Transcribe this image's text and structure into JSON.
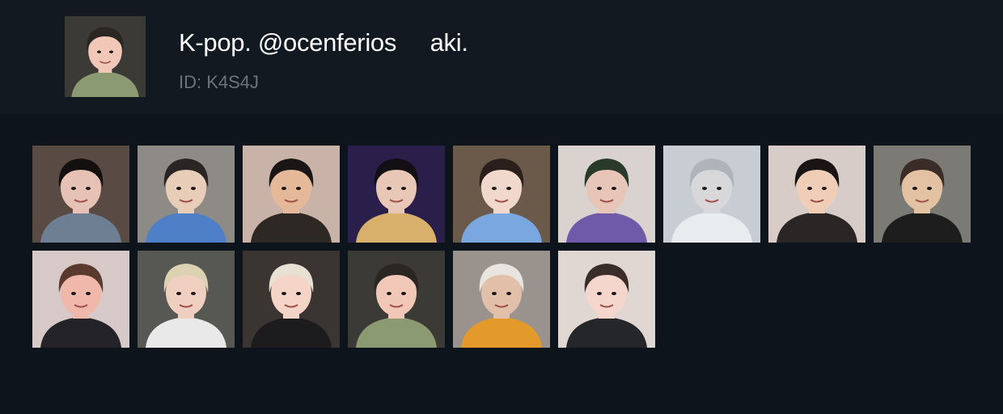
{
  "pack": {
    "title": "K-pop. @ocenferios     aki.",
    "id_label": "ID: K4S4J",
    "cover_sticker": "sticker-hand-over-face"
  },
  "stickers": [
    {
      "name": "sticker-smiling-girl-waving",
      "bg": "#5a4a44",
      "skin": "#e6c2b4",
      "hair": "#141010",
      "cloth": "#6e7f93"
    },
    {
      "name": "sticker-boy-with-camera",
      "bg": "#8e8a86",
      "skin": "#e8cdb8",
      "hair": "#2a2424",
      "cloth": "#4f7fc6"
    },
    {
      "name": "sticker-boy-black-beret",
      "bg": "#c9b3a8",
      "skin": "#e5b89a",
      "hair": "#1b1616",
      "cloth": "#2e2824"
    },
    {
      "name": "sticker-boy-side-profile-neon",
      "bg": "#2a1f4a",
      "skin": "#e8c7b7",
      "hair": "#121014",
      "cloth": "#d9b06b"
    },
    {
      "name": "sticker-boy-at-microphone",
      "bg": "#6b5a4a",
      "skin": "#f0d8cc",
      "hair": "#2b1f1c",
      "cloth": "#7aa7e0"
    },
    {
      "name": "sticker-masked-face-pink-text",
      "bg": "#d9d2cf",
      "skin": "#e7c6b8",
      "hair": "#2a3a2a",
      "cloth": "#6e5aa8"
    },
    {
      "name": "sticker-blurry-white-shirt",
      "bg": "#c7cdd2",
      "skin": "#d8d8da",
      "hair": "#aeb4ba",
      "cloth": "#e8ecef"
    },
    {
      "name": "sticker-smiling-boy-selfie",
      "bg": "#d8ccc8",
      "skin": "#efcdb6",
      "hair": "#1b1414",
      "cloth": "#2b2626"
    },
    {
      "name": "sticker-boy-drinking-bottle",
      "bg": "#7c7a74",
      "skin": "#e3c2a4",
      "hair": "#3a2c26",
      "cloth": "#1d1d1d"
    },
    {
      "name": "sticker-boy-fingers-on-lips",
      "bg": "#d6c9c8",
      "skin": "#f0b8aa",
      "hair": "#5a3a2e",
      "cloth": "#242428"
    },
    {
      "name": "sticker-blonde-drinking-straw",
      "bg": "#575854",
      "skin": "#eecfc0",
      "hair": "#dcd2b2",
      "cloth": "#e9e9ea"
    },
    {
      "name": "sticker-blonde-girl-laughing",
      "bg": "#3a3432",
      "skin": "#f3d4c6",
      "hair": "#e8e0d2",
      "cloth": "#1c1c1f"
    },
    {
      "name": "sticker-hand-over-face",
      "bg": "#3b3a36",
      "skin": "#f1c7b8",
      "hair": "#2a2622",
      "cloth": "#8c9a72"
    },
    {
      "name": "sticker-hoodie-boy-snack-bag",
      "bg": "#9a928c",
      "skin": "#e2bfa8",
      "hair": "#e8e4df",
      "cloth": "#e49a2a"
    },
    {
      "name": "sticker-girl-ok-hand-sign",
      "bg": "#e0d6d2",
      "skin": "#f4d6cd",
      "hair": "#3a2c28",
      "cloth": "#24262a"
    }
  ]
}
